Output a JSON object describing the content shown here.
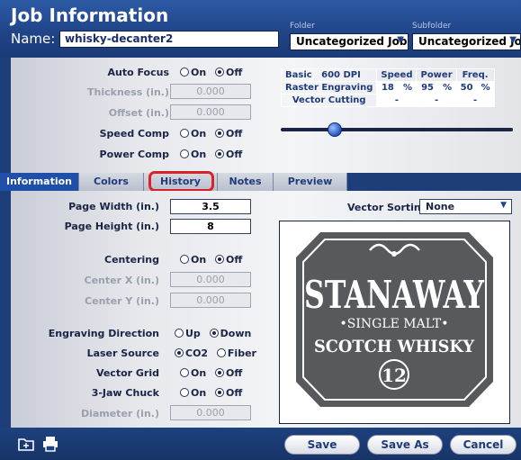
{
  "header": {
    "title": "Job Information",
    "name_label": "Name:",
    "name_value": "whisky-decanter2",
    "folder_label": "Folder",
    "folder_value": "Uncategorized Jobs",
    "subfolder_label": "Subfolder",
    "subfolder_value": "Uncategorized Jobs"
  },
  "settings": {
    "auto_focus": {
      "label": "Auto Focus",
      "on": "On",
      "off": "Off",
      "selected": "off"
    },
    "thickness": {
      "label": "Thickness (in.)",
      "value": "0.000"
    },
    "offset": {
      "label": "Offset (in.)",
      "value": "0.000"
    },
    "speed_comp": {
      "label": "Speed Comp",
      "on": "On",
      "off": "Off",
      "selected": "off"
    },
    "power_comp": {
      "label": "Power Comp",
      "on": "On",
      "off": "Off",
      "selected": "off"
    }
  },
  "power_table": {
    "basic": "Basic",
    "dpi": "600 DPI",
    "headers": [
      "Speed",
      "Power",
      "Freq."
    ],
    "raster_label": "Raster Engraving",
    "raster_speed": "18",
    "raster_power": "95",
    "raster_freq": "50",
    "percent": "%",
    "vector_label": "Vector Cutting",
    "vector_speed": "-",
    "vector_power": "-",
    "vector_freq": "-"
  },
  "tabs": [
    "Information",
    "Colors",
    "History",
    "Notes",
    "Preview"
  ],
  "info": {
    "page_width": {
      "label": "Page Width (in.)",
      "value": "3.5"
    },
    "page_height": {
      "label": "Page Height (in.)",
      "value": "8"
    },
    "centering": {
      "label": "Centering",
      "on": "On",
      "off": "Off",
      "selected": "off"
    },
    "center_x": {
      "label": "Center X (in.)",
      "value": "0.000"
    },
    "center_y": {
      "label": "Center Y (in.)",
      "value": "0.000"
    },
    "engraving_direction": {
      "label": "Engraving Direction",
      "up": "Up",
      "down": "Down",
      "selected": "down"
    },
    "laser_source": {
      "label": "Laser Source",
      "co2": "CO2",
      "fiber": "Fiber",
      "selected": "co2"
    },
    "vector_grid": {
      "label": "Vector Grid",
      "on": "On",
      "off": "Off",
      "selected": "off"
    },
    "jaw_chuck": {
      "label": "3-Jaw Chuck",
      "on": "On",
      "off": "Off",
      "selected": "off"
    },
    "diameter": {
      "label": "Diameter (in.)",
      "value": "0.000"
    },
    "vector_sorting": {
      "label": "Vector Sorting",
      "value": "None"
    }
  },
  "preview": {
    "brand": "STANAWAY",
    "line2": "•SINGLE MALT•",
    "line3": "SCOTCH WHISKY",
    "number": "12"
  },
  "footer": {
    "save": "Save",
    "save_as": "Save As",
    "cancel": "Cancel"
  },
  "icons": {
    "folder": "folder-icon",
    "print": "print-icon",
    "dropdown": "chevron-down-icon"
  },
  "colors": {
    "header": "#1f4386",
    "active_tab": "#1f4fa8",
    "highlight": "#d9232a"
  }
}
